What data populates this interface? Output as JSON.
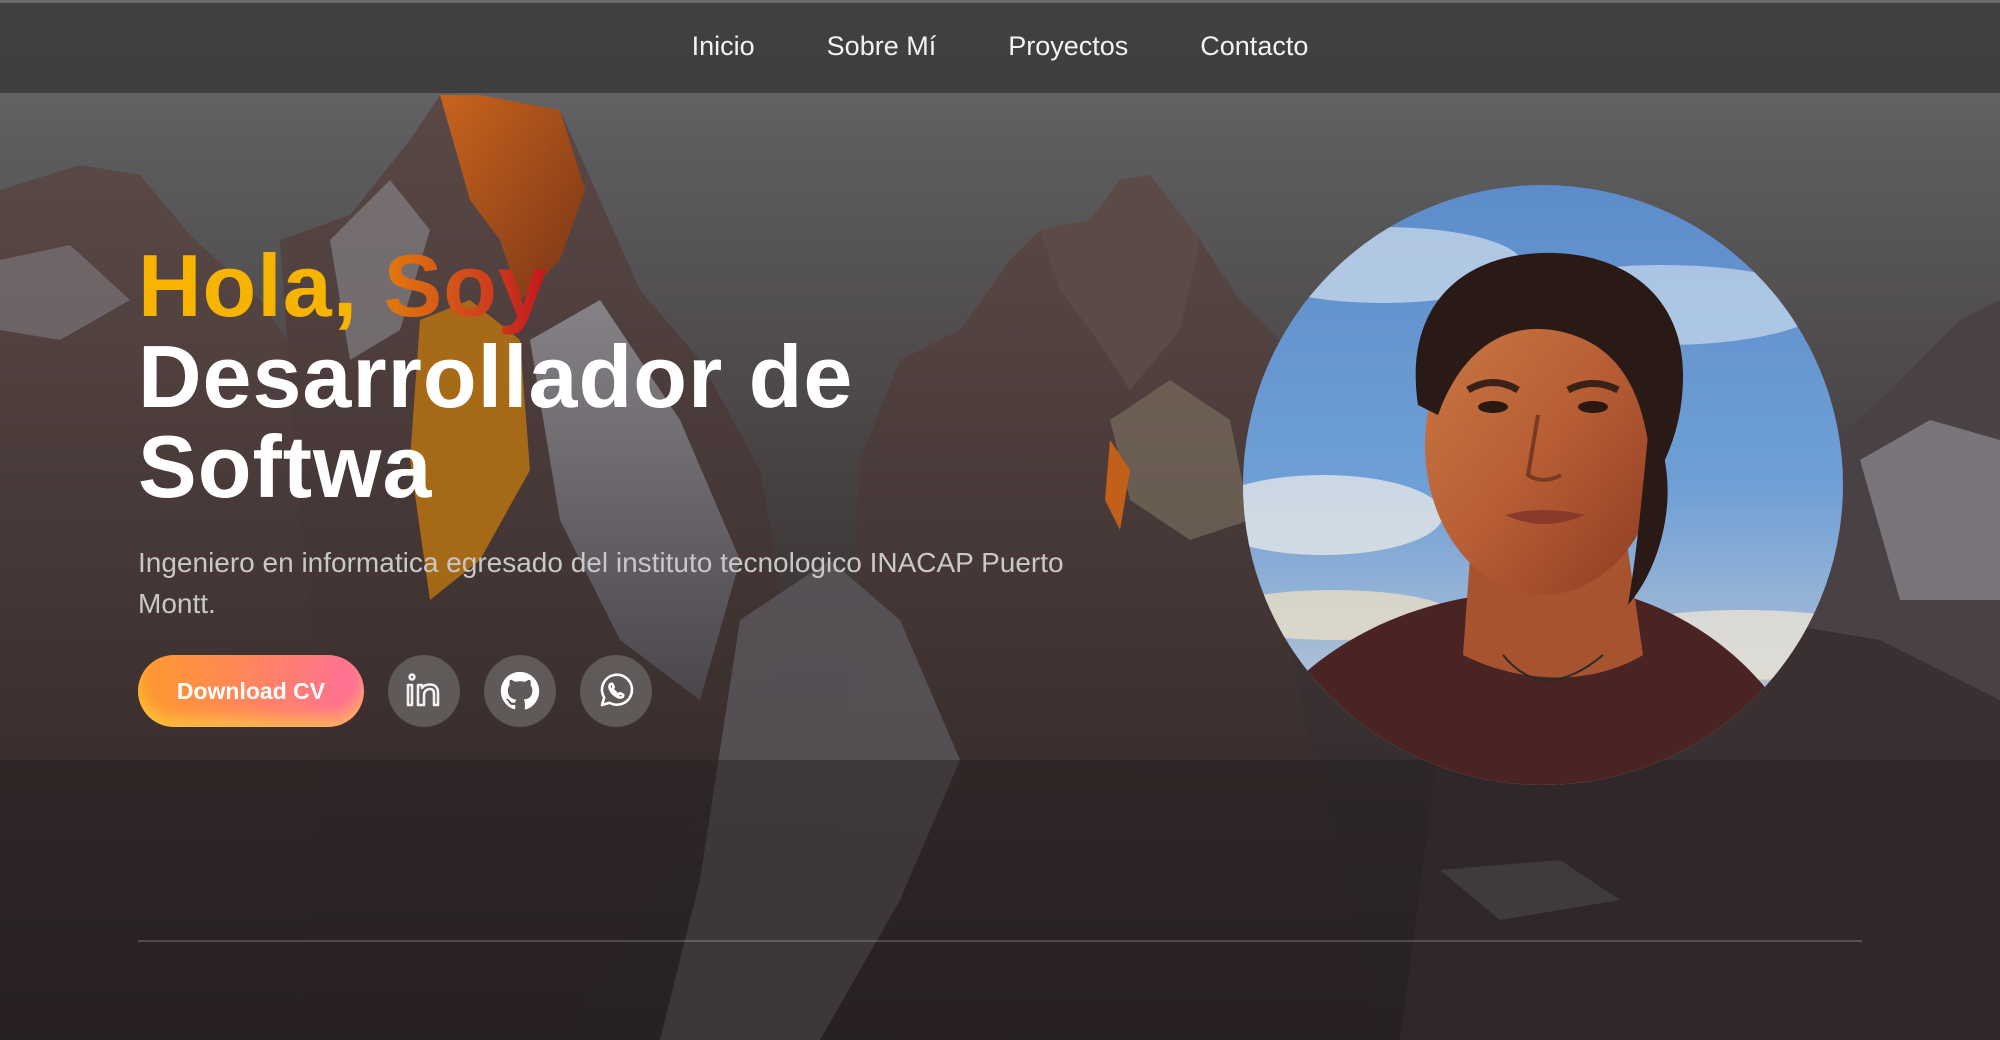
{
  "nav": {
    "items": [
      {
        "label": "Inicio"
      },
      {
        "label": "Sobre Mí"
      },
      {
        "label": "Proyectos"
      },
      {
        "label": "Contacto"
      }
    ]
  },
  "hero": {
    "greeting_word1": "Hola,",
    "greeting_word2": "Soy",
    "role_line1": "Desarrollador de",
    "role_line2": "Softwa",
    "description": "Ingeniero en informatica egresado del instituto tecnologico INACAP Puerto Montt.",
    "cv_button": "Download CV"
  },
  "social": [
    {
      "icon": "linkedin-icon"
    },
    {
      "icon": "github-icon"
    },
    {
      "icon": "whatsapp-icon"
    }
  ],
  "colors": {
    "accent_yellow": "#f6b300",
    "accent_orange": "#d0471d",
    "accent_red": "#c1161d",
    "button_from": "#fd9a2c",
    "button_to": "#ff6f9b"
  }
}
